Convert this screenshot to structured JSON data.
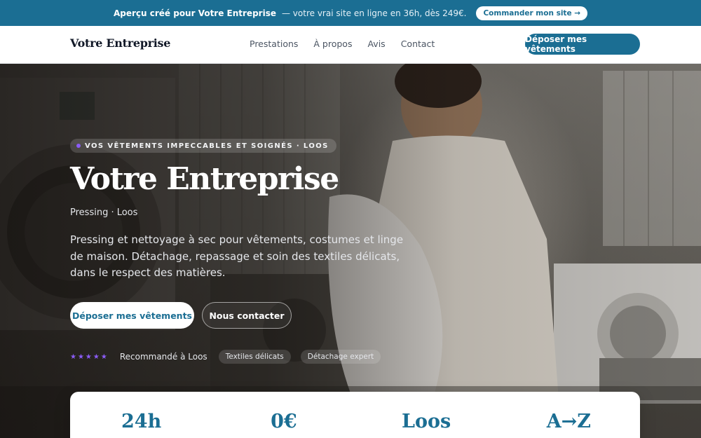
{
  "promo": {
    "lead": "Aperçu créé pour Votre Entreprise",
    "text": "— votre vrai site en ligne en 36h, dès 249€.",
    "button": "Commander mon site →"
  },
  "header": {
    "brand": "Votre Entreprise",
    "nav": [
      "Prestations",
      "À propos",
      "Avis",
      "Contact"
    ],
    "cta": "Déposer mes vêtements"
  },
  "hero": {
    "eyebrow": "VOS VÊTEMENTS IMPECCABLES ET SOIGNÉS · LOOS",
    "title": "Votre Entreprise",
    "subtitle": "Pressing · Loos",
    "description": "Pressing et nettoyage à sec pour vêtements, costumes et linge de maison. Détachage, repassage et soin des textiles délicats, dans le respect des matières.",
    "primary_button": "Déposer mes vêtements",
    "secondary_button": "Nous contacter",
    "rating_stars": "★★★★★",
    "rating_text": "Recommandé à Loos",
    "tags": [
      "Textiles délicats",
      "Détachage expert"
    ]
  },
  "stats": [
    "24h",
    "0€",
    "Loos",
    "A→Z"
  ],
  "colors": {
    "brand": "#1b6e93",
    "accent": "#8b5cf6"
  }
}
